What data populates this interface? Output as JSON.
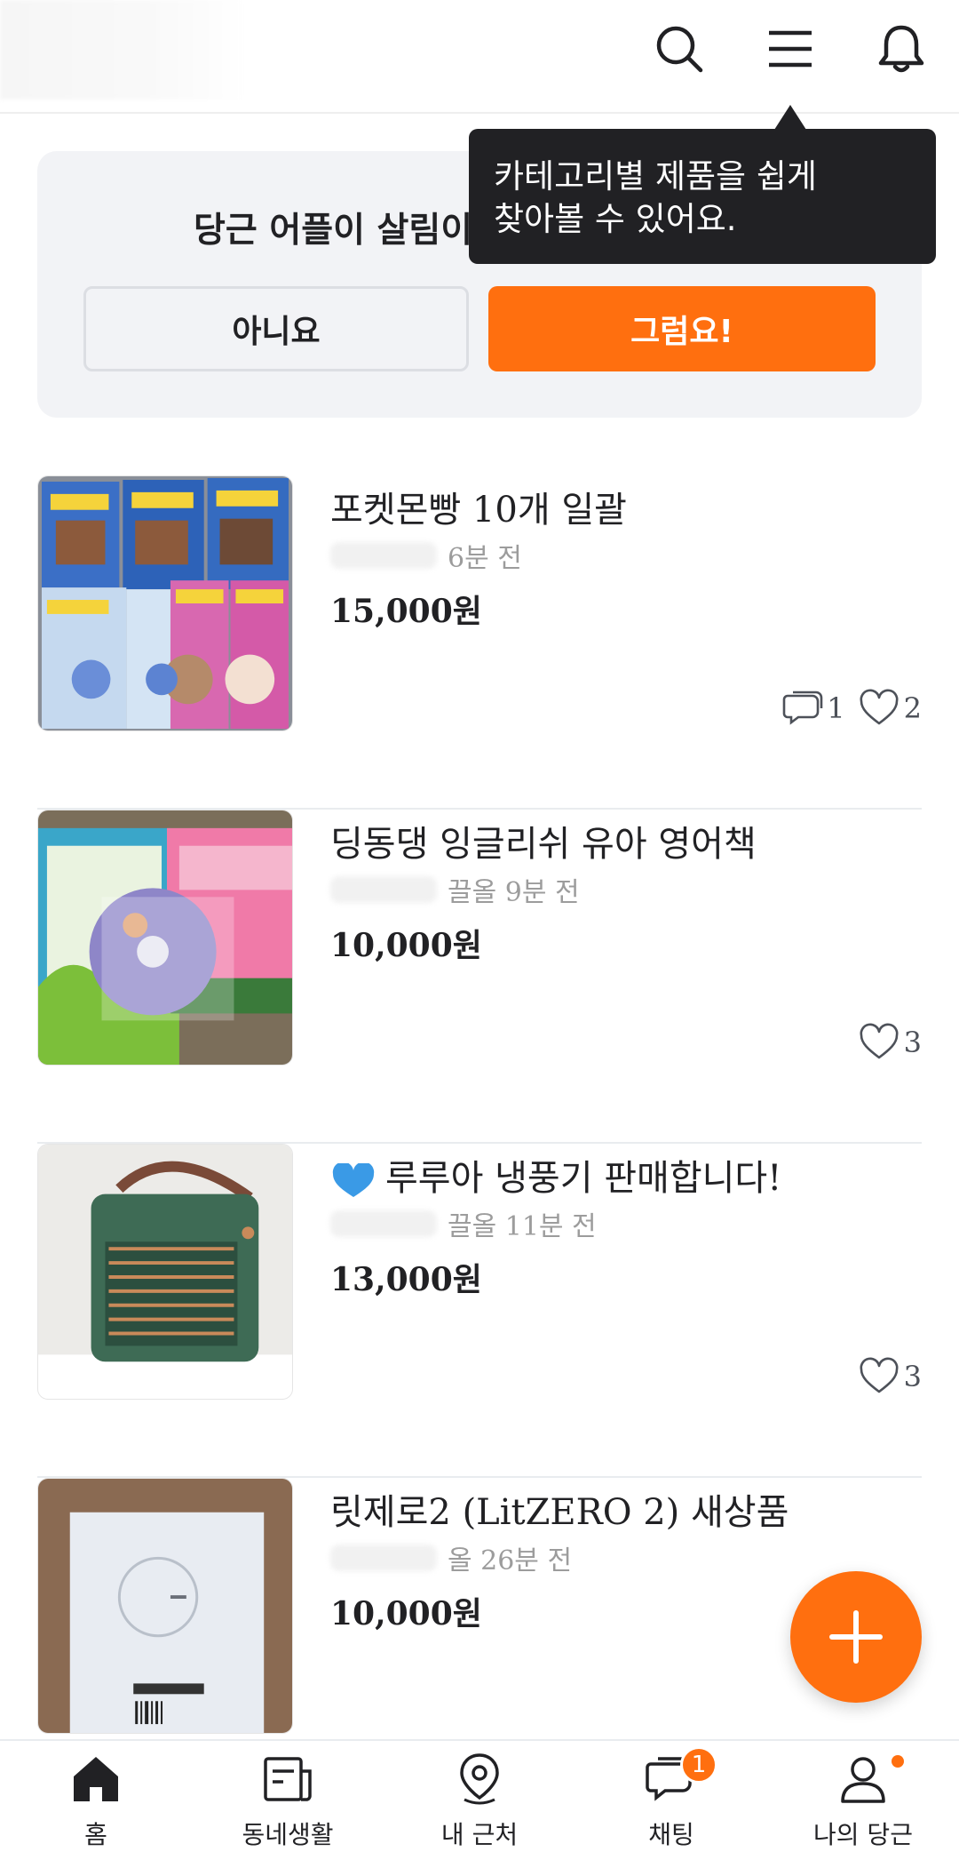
{
  "header": {
    "icons": [
      "search-icon",
      "menu-icon",
      "bell-icon"
    ]
  },
  "tooltip": {
    "line1": "카테고리별 제품을 쉽게",
    "line2": "찾아볼 수 있어요."
  },
  "banner": {
    "question": "당근 어플이 살림이",
    "no_label": "아니요",
    "yes_label": "그럼요!"
  },
  "listings": [
    {
      "title": "포켓몬빵 10개 일괄",
      "time": "6분 전",
      "price": "15,000원",
      "chats": "1",
      "likes": "2"
    },
    {
      "title": "딩동댕 잉글리쉬 유아 영어책",
      "time": "끌올 9분 전",
      "price": "10,000원",
      "likes": "3"
    },
    {
      "title": "루루아 냉풍기 판매합니다!",
      "title_emoji": "blue-heart-emoji",
      "time": "끌올 11분 전",
      "price": "13,000원",
      "likes": "3"
    },
    {
      "title": "릿제로2 (LitZERO 2)  새상품",
      "time": "올 26분 전",
      "price": "10,000원"
    }
  ],
  "fab": {
    "icon": "plus-icon"
  },
  "bottom_nav": [
    {
      "label": "홈",
      "icon": "home-icon"
    },
    {
      "label": "동네생활",
      "icon": "neighborhood-icon"
    },
    {
      "label": "내 근처",
      "icon": "location-pin-icon"
    },
    {
      "label": "채팅",
      "icon": "chat-icon",
      "badge": "1"
    },
    {
      "label": "나의 당근",
      "icon": "profile-icon"
    }
  ],
  "colors": {
    "accent": "#ff6f0f",
    "tooltip_bg": "#212124",
    "banner_bg": "#f2f3f6"
  }
}
